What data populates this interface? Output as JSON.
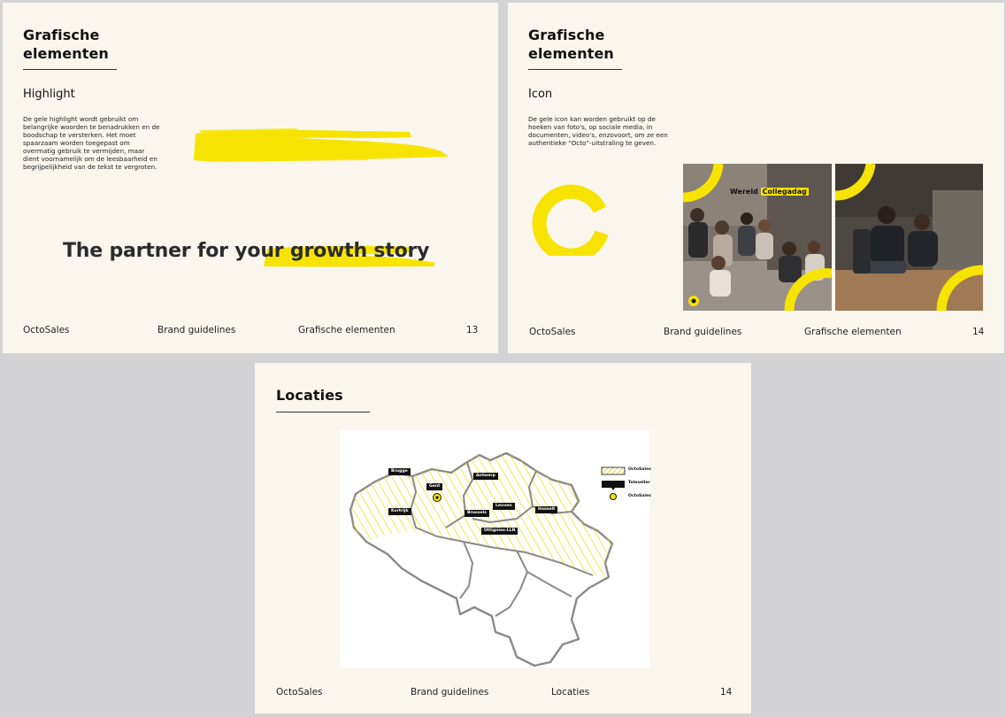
{
  "slides": {
    "highlight": {
      "title": "Grafische\nelementen",
      "subtitle": "Highlight",
      "body": "De gele highlight wordt gebruikt om belangrijke woorden te benadrukken en de boodschap te versterken. Het moet spaarzaam worden toegepast om overmatig gebruik te vermijden, maar dient voornamelijk om de leesbaarheid en begrijpelijkheid van de tekst te vergroten.",
      "tagline_start": "The partner for your ",
      "tagline_highlight": "growth story",
      "footer": {
        "brand": "OctoSales",
        "doc": "Brand guidelines",
        "section": "Grafische elementen",
        "page": "13"
      }
    },
    "icon": {
      "title": "Grafische\nelementen",
      "subtitle": "Icon",
      "body": "De gele icon kan worden gebruikt op de hoeken van foto's, op sociale media, in documenten, video's, enzovoort, om ze een authentieke “Octo”-uitstraling te geven.",
      "photo_caption_start": "Wereld ",
      "photo_caption_highlight": "Collegadag",
      "footer": {
        "brand": "OctoSales",
        "doc": "Brand guidelines",
        "section": "Grafische elementen",
        "page": "14"
      }
    },
    "locaties": {
      "title": "Locaties",
      "map_tags": [
        "Brugge",
        "Gent",
        "Antwerp",
        "Kortrijk",
        "Brussels",
        "Leuven",
        "Hasselt",
        "Ottignies-LLN"
      ],
      "legend": [
        "OctoSales",
        "Teleseller",
        "OctoSales"
      ],
      "footer": {
        "brand": "OctoSales",
        "doc": "Brand guidelines",
        "section": "Locaties",
        "page": "14"
      }
    }
  },
  "colors": {
    "background": "#d3d3d5",
    "slide": "#faf6ee",
    "accent_yellow": "#f6e400",
    "text": "#1d1d1f"
  }
}
